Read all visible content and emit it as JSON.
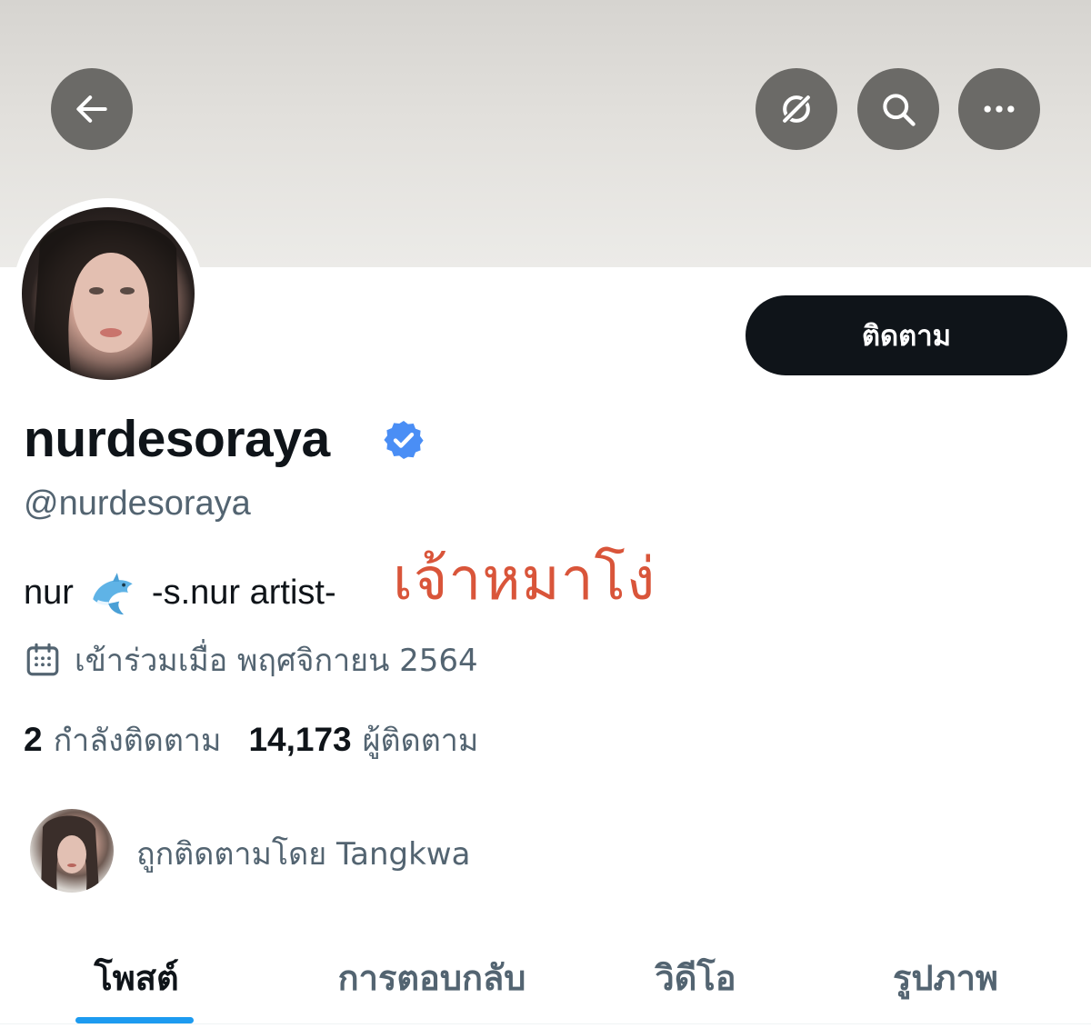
{
  "header": {
    "back_icon": "arrow-left-icon",
    "grok_icon": "grok-icon",
    "search_icon": "search-icon",
    "more_icon": "more-horizontal-icon",
    "button_color": "#6b6a67"
  },
  "profile": {
    "follow_label": "ติดตาม",
    "display_name": "nurdesoraya",
    "verified": true,
    "verified_color": "#4a8ef5",
    "handle": "@nurdesoraya",
    "bio_prefix": "nur",
    "bio_emoji": "dolphin-icon",
    "bio_suffix": "-s.nur artist-",
    "joined_icon": "calendar-icon",
    "joined_text": "เข้าร่วมเมื่อ พฤศจิกายน 2564",
    "following_count": "2",
    "following_label": "กำลังติดตาม",
    "followers_count": "14,173",
    "followers_label": "ผู้ติดตาม",
    "followed_by_text": "ถูกติดตามโดย Tangkwa"
  },
  "annotation": {
    "text": "เจ้าหมาโง่",
    "color": "#d9553a"
  },
  "tabs": [
    {
      "label": "โพสต์",
      "active": true
    },
    {
      "label": "การตอบกลับ",
      "active": false
    },
    {
      "label": "วิดีโอ",
      "active": false
    },
    {
      "label": "รูปภาพ",
      "active": false
    }
  ],
  "accent_color": "#1d9bf0"
}
